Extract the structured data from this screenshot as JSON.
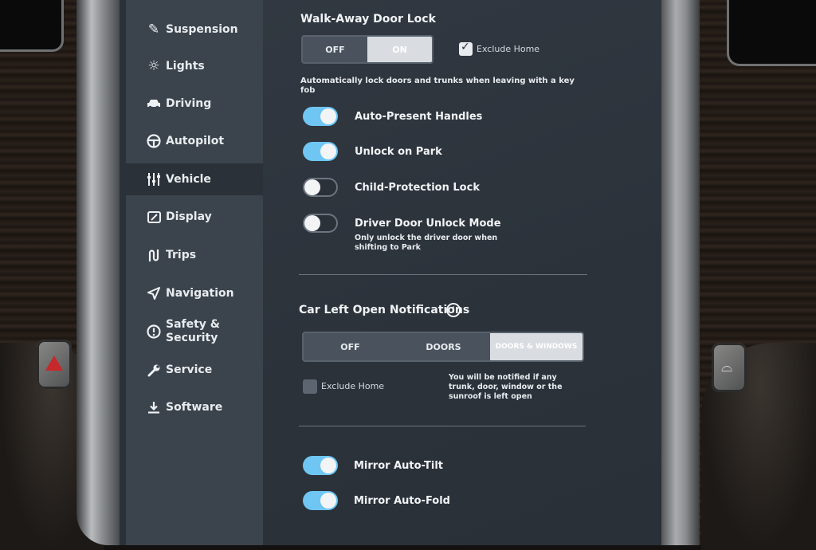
{
  "sidebar": {
    "items": [
      {
        "label": "Suspension",
        "icon": "suspension-icon"
      },
      {
        "label": "Lights",
        "icon": "lights-icon"
      },
      {
        "label": "Driving",
        "icon": "car-icon"
      },
      {
        "label": "Autopilot",
        "icon": "steering-wheel-icon"
      },
      {
        "label": "Vehicle",
        "icon": "sliders-icon",
        "active": true
      },
      {
        "label": "Display",
        "icon": "display-icon"
      },
      {
        "label": "Trips",
        "icon": "trips-icon"
      },
      {
        "label": "Navigation",
        "icon": "navigation-icon"
      },
      {
        "label": "Safety & Security",
        "icon": "alert-circle-icon"
      },
      {
        "label": "Service",
        "icon": "wrench-icon"
      },
      {
        "label": "Software",
        "icon": "download-icon"
      }
    ]
  },
  "walk_away": {
    "title": "Walk-Away Door Lock",
    "options": [
      "OFF",
      "ON"
    ],
    "selected": "ON",
    "exclude_home": {
      "label": "Exclude Home",
      "checked": true
    },
    "description": "Automatically lock doors and trunks when leaving with a key fob"
  },
  "toggles": [
    {
      "label": "Auto-Present Handles",
      "on": true
    },
    {
      "label": "Unlock on Park",
      "on": true
    },
    {
      "label": "Child-Protection Lock",
      "on": false
    },
    {
      "label": "Driver Door Unlock Mode",
      "on": false,
      "description": "Only unlock the driver door when shifting to Park"
    }
  ],
  "car_left_open": {
    "title": "Car Left Open Notifications",
    "options": [
      "OFF",
      "DOORS",
      "DOORS & WINDOWS"
    ],
    "selected": "DOORS & WINDOWS",
    "exclude_home": {
      "label": "Exclude Home",
      "checked": false
    },
    "description": "You will be notified if any trunk, door, window or the sunroof is left open"
  },
  "mirrors": [
    {
      "label": "Mirror Auto-Tilt",
      "on": true
    },
    {
      "label": "Mirror Auto-Fold",
      "on": true
    }
  ],
  "colors": {
    "accent": "#6fc6f3",
    "sidebar": "#3b434c",
    "background": "#2b323a"
  }
}
